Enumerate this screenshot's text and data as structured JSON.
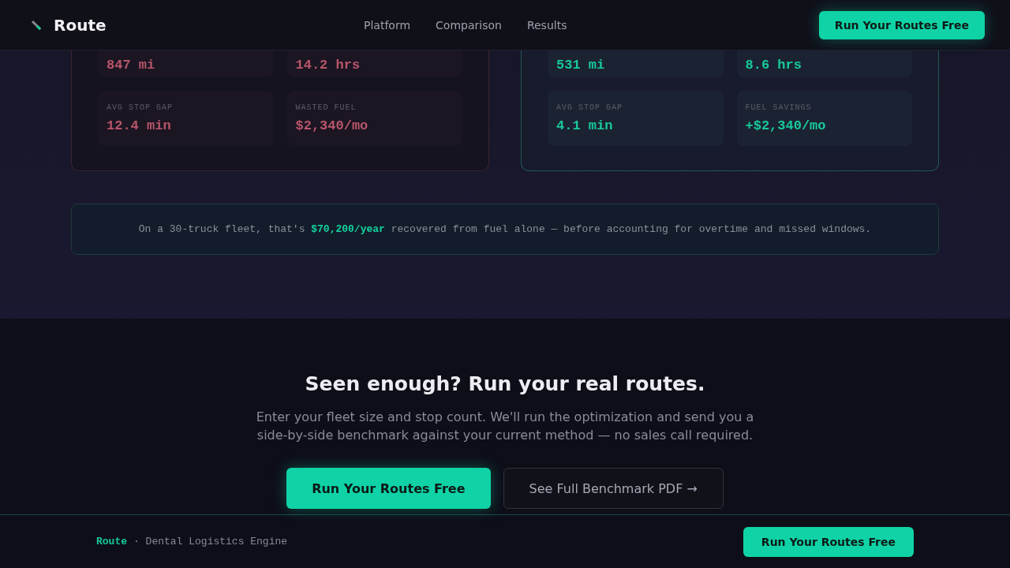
{
  "header": {
    "brand": "Route",
    "nav": [
      "Platform",
      "Comparison",
      "Results"
    ],
    "cta": "Run Your Routes Free"
  },
  "comparison": {
    "panels": [
      {
        "kind": "before",
        "tiles": [
          {
            "value": "847 mi"
          },
          {
            "value": "14.2 hrs"
          },
          {
            "label": "AVG STOP GAP",
            "value": "12.4 min"
          },
          {
            "label": "WASTED FUEL",
            "value": "$2,340/mo"
          }
        ]
      },
      {
        "kind": "after",
        "tiles": [
          {
            "value": "531 mi"
          },
          {
            "value": "8.6 hrs"
          },
          {
            "label": "AVG STOP GAP",
            "value": "4.1 min"
          },
          {
            "label": "FUEL SAVINGS",
            "value": "+$2,340/mo"
          }
        ]
      }
    ],
    "note": "On a 30-truck fleet, that's **$70,200/year** recovered from fuel alone — before accounting for overtime and missed windows."
  },
  "cta": {
    "title": "Seen enough? Run your real routes.",
    "body": "Enter your fleet size and stop count. We'll run the optimization and send you a side-by-side benchmark against your current method — no sales call required.",
    "buttons": [
      {
        "label": "Run Your Routes Free",
        "kind": "primary"
      },
      {
        "label": "See Full Benchmark PDF →",
        "kind": "secondary"
      }
    ]
  },
  "footer": {
    "brand": "Route",
    "tagline": "· Dental Logistics Engine",
    "cta": "Run Your Routes Free"
  }
}
